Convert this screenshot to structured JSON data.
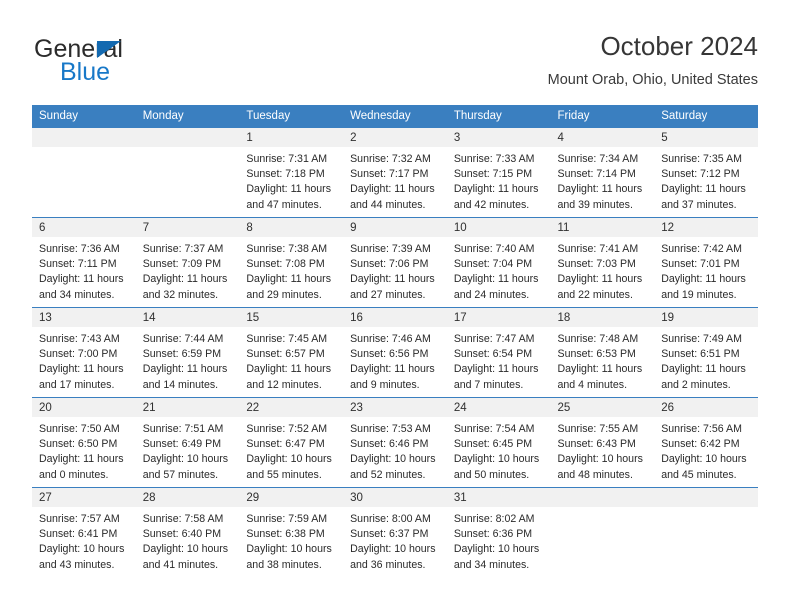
{
  "brand": {
    "name_top": "General",
    "name_bottom": "Blue",
    "accent_color": "#1878c8",
    "triangle_color": "#1369b0"
  },
  "header": {
    "title": "October 2024",
    "subtitle": "Mount Orab, Ohio, United States"
  },
  "calendar": {
    "header_bg": "#3a7fc0",
    "daynum_bg": "#f1f1f1",
    "weekdays": [
      "Sunday",
      "Monday",
      "Tuesday",
      "Wednesday",
      "Thursday",
      "Friday",
      "Saturday"
    ],
    "weeks": [
      [
        {
          "day": "",
          "blank": true,
          "sunrise": "",
          "sunset": "",
          "daylight1": "",
          "daylight2": ""
        },
        {
          "day": "",
          "blank": true,
          "sunrise": "",
          "sunset": "",
          "daylight1": "",
          "daylight2": ""
        },
        {
          "day": "1",
          "sunrise": "Sunrise: 7:31 AM",
          "sunset": "Sunset: 7:18 PM",
          "daylight1": "Daylight: 11 hours",
          "daylight2": "and 47 minutes."
        },
        {
          "day": "2",
          "sunrise": "Sunrise: 7:32 AM",
          "sunset": "Sunset: 7:17 PM",
          "daylight1": "Daylight: 11 hours",
          "daylight2": "and 44 minutes."
        },
        {
          "day": "3",
          "sunrise": "Sunrise: 7:33 AM",
          "sunset": "Sunset: 7:15 PM",
          "daylight1": "Daylight: 11 hours",
          "daylight2": "and 42 minutes."
        },
        {
          "day": "4",
          "sunrise": "Sunrise: 7:34 AM",
          "sunset": "Sunset: 7:14 PM",
          "daylight1": "Daylight: 11 hours",
          "daylight2": "and 39 minutes."
        },
        {
          "day": "5",
          "sunrise": "Sunrise: 7:35 AM",
          "sunset": "Sunset: 7:12 PM",
          "daylight1": "Daylight: 11 hours",
          "daylight2": "and 37 minutes."
        }
      ],
      [
        {
          "day": "6",
          "sunrise": "Sunrise: 7:36 AM",
          "sunset": "Sunset: 7:11 PM",
          "daylight1": "Daylight: 11 hours",
          "daylight2": "and 34 minutes."
        },
        {
          "day": "7",
          "sunrise": "Sunrise: 7:37 AM",
          "sunset": "Sunset: 7:09 PM",
          "daylight1": "Daylight: 11 hours",
          "daylight2": "and 32 minutes."
        },
        {
          "day": "8",
          "sunrise": "Sunrise: 7:38 AM",
          "sunset": "Sunset: 7:08 PM",
          "daylight1": "Daylight: 11 hours",
          "daylight2": "and 29 minutes."
        },
        {
          "day": "9",
          "sunrise": "Sunrise: 7:39 AM",
          "sunset": "Sunset: 7:06 PM",
          "daylight1": "Daylight: 11 hours",
          "daylight2": "and 27 minutes."
        },
        {
          "day": "10",
          "sunrise": "Sunrise: 7:40 AM",
          "sunset": "Sunset: 7:04 PM",
          "daylight1": "Daylight: 11 hours",
          "daylight2": "and 24 minutes."
        },
        {
          "day": "11",
          "sunrise": "Sunrise: 7:41 AM",
          "sunset": "Sunset: 7:03 PM",
          "daylight1": "Daylight: 11 hours",
          "daylight2": "and 22 minutes."
        },
        {
          "day": "12",
          "sunrise": "Sunrise: 7:42 AM",
          "sunset": "Sunset: 7:01 PM",
          "daylight1": "Daylight: 11 hours",
          "daylight2": "and 19 minutes."
        }
      ],
      [
        {
          "day": "13",
          "sunrise": "Sunrise: 7:43 AM",
          "sunset": "Sunset: 7:00 PM",
          "daylight1": "Daylight: 11 hours",
          "daylight2": "and 17 minutes."
        },
        {
          "day": "14",
          "sunrise": "Sunrise: 7:44 AM",
          "sunset": "Sunset: 6:59 PM",
          "daylight1": "Daylight: 11 hours",
          "daylight2": "and 14 minutes."
        },
        {
          "day": "15",
          "sunrise": "Sunrise: 7:45 AM",
          "sunset": "Sunset: 6:57 PM",
          "daylight1": "Daylight: 11 hours",
          "daylight2": "and 12 minutes."
        },
        {
          "day": "16",
          "sunrise": "Sunrise: 7:46 AM",
          "sunset": "Sunset: 6:56 PM",
          "daylight1": "Daylight: 11 hours",
          "daylight2": "and 9 minutes."
        },
        {
          "day": "17",
          "sunrise": "Sunrise: 7:47 AM",
          "sunset": "Sunset: 6:54 PM",
          "daylight1": "Daylight: 11 hours",
          "daylight2": "and 7 minutes."
        },
        {
          "day": "18",
          "sunrise": "Sunrise: 7:48 AM",
          "sunset": "Sunset: 6:53 PM",
          "daylight1": "Daylight: 11 hours",
          "daylight2": "and 4 minutes."
        },
        {
          "day": "19",
          "sunrise": "Sunrise: 7:49 AM",
          "sunset": "Sunset: 6:51 PM",
          "daylight1": "Daylight: 11 hours",
          "daylight2": "and 2 minutes."
        }
      ],
      [
        {
          "day": "20",
          "sunrise": "Sunrise: 7:50 AM",
          "sunset": "Sunset: 6:50 PM",
          "daylight1": "Daylight: 11 hours",
          "daylight2": "and 0 minutes."
        },
        {
          "day": "21",
          "sunrise": "Sunrise: 7:51 AM",
          "sunset": "Sunset: 6:49 PM",
          "daylight1": "Daylight: 10 hours",
          "daylight2": "and 57 minutes."
        },
        {
          "day": "22",
          "sunrise": "Sunrise: 7:52 AM",
          "sunset": "Sunset: 6:47 PM",
          "daylight1": "Daylight: 10 hours",
          "daylight2": "and 55 minutes."
        },
        {
          "day": "23",
          "sunrise": "Sunrise: 7:53 AM",
          "sunset": "Sunset: 6:46 PM",
          "daylight1": "Daylight: 10 hours",
          "daylight2": "and 52 minutes."
        },
        {
          "day": "24",
          "sunrise": "Sunrise: 7:54 AM",
          "sunset": "Sunset: 6:45 PM",
          "daylight1": "Daylight: 10 hours",
          "daylight2": "and 50 minutes."
        },
        {
          "day": "25",
          "sunrise": "Sunrise: 7:55 AM",
          "sunset": "Sunset: 6:43 PM",
          "daylight1": "Daylight: 10 hours",
          "daylight2": "and 48 minutes."
        },
        {
          "day": "26",
          "sunrise": "Sunrise: 7:56 AM",
          "sunset": "Sunset: 6:42 PM",
          "daylight1": "Daylight: 10 hours",
          "daylight2": "and 45 minutes."
        }
      ],
      [
        {
          "day": "27",
          "sunrise": "Sunrise: 7:57 AM",
          "sunset": "Sunset: 6:41 PM",
          "daylight1": "Daylight: 10 hours",
          "daylight2": "and 43 minutes."
        },
        {
          "day": "28",
          "sunrise": "Sunrise: 7:58 AM",
          "sunset": "Sunset: 6:40 PM",
          "daylight1": "Daylight: 10 hours",
          "daylight2": "and 41 minutes."
        },
        {
          "day": "29",
          "sunrise": "Sunrise: 7:59 AM",
          "sunset": "Sunset: 6:38 PM",
          "daylight1": "Daylight: 10 hours",
          "daylight2": "and 38 minutes."
        },
        {
          "day": "30",
          "sunrise": "Sunrise: 8:00 AM",
          "sunset": "Sunset: 6:37 PM",
          "daylight1": "Daylight: 10 hours",
          "daylight2": "and 36 minutes."
        },
        {
          "day": "31",
          "sunrise": "Sunrise: 8:02 AM",
          "sunset": "Sunset: 6:36 PM",
          "daylight1": "Daylight: 10 hours",
          "daylight2": "and 34 minutes."
        },
        {
          "day": "",
          "blank": true,
          "sunrise": "",
          "sunset": "",
          "daylight1": "",
          "daylight2": ""
        },
        {
          "day": "",
          "blank": true,
          "sunrise": "",
          "sunset": "",
          "daylight1": "",
          "daylight2": ""
        }
      ]
    ]
  }
}
